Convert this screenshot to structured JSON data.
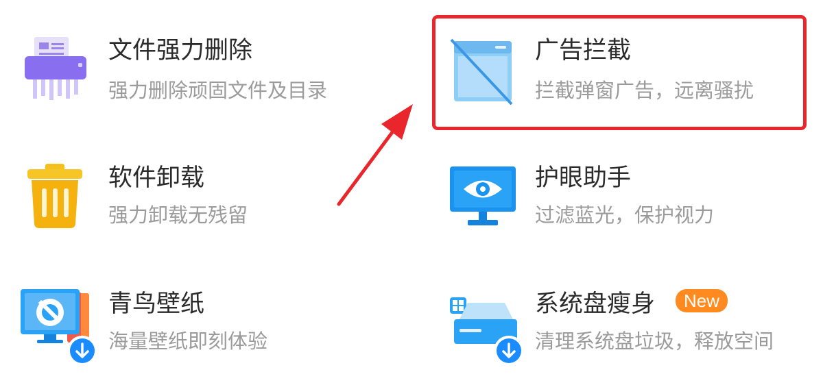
{
  "tools": [
    {
      "title": "文件强力删除",
      "desc": "强力删除顽固文件及目录",
      "icon": "shredder-icon"
    },
    {
      "title": "广告拦截",
      "desc": "拦截弹窗广告，远离骚扰",
      "icon": "ad-block-icon"
    },
    {
      "title": "软件卸载",
      "desc": "强力卸载无残留",
      "icon": "trash-can-icon"
    },
    {
      "title": "护眼助手",
      "desc": "过滤蓝光，保护视力",
      "icon": "eye-monitor-icon"
    },
    {
      "title": "青鸟壁纸",
      "desc": "海量壁纸即刻体验",
      "icon": "wallpaper-icon"
    },
    {
      "title": "系统盘瘦身",
      "desc": "清理系统盘垃圾，释放空间",
      "icon": "disk-cleanup-icon",
      "badge": "New"
    }
  ],
  "colors": {
    "highlight": "#e8262b",
    "badge": "#ff8a1f",
    "accent": "#1a8cff"
  }
}
